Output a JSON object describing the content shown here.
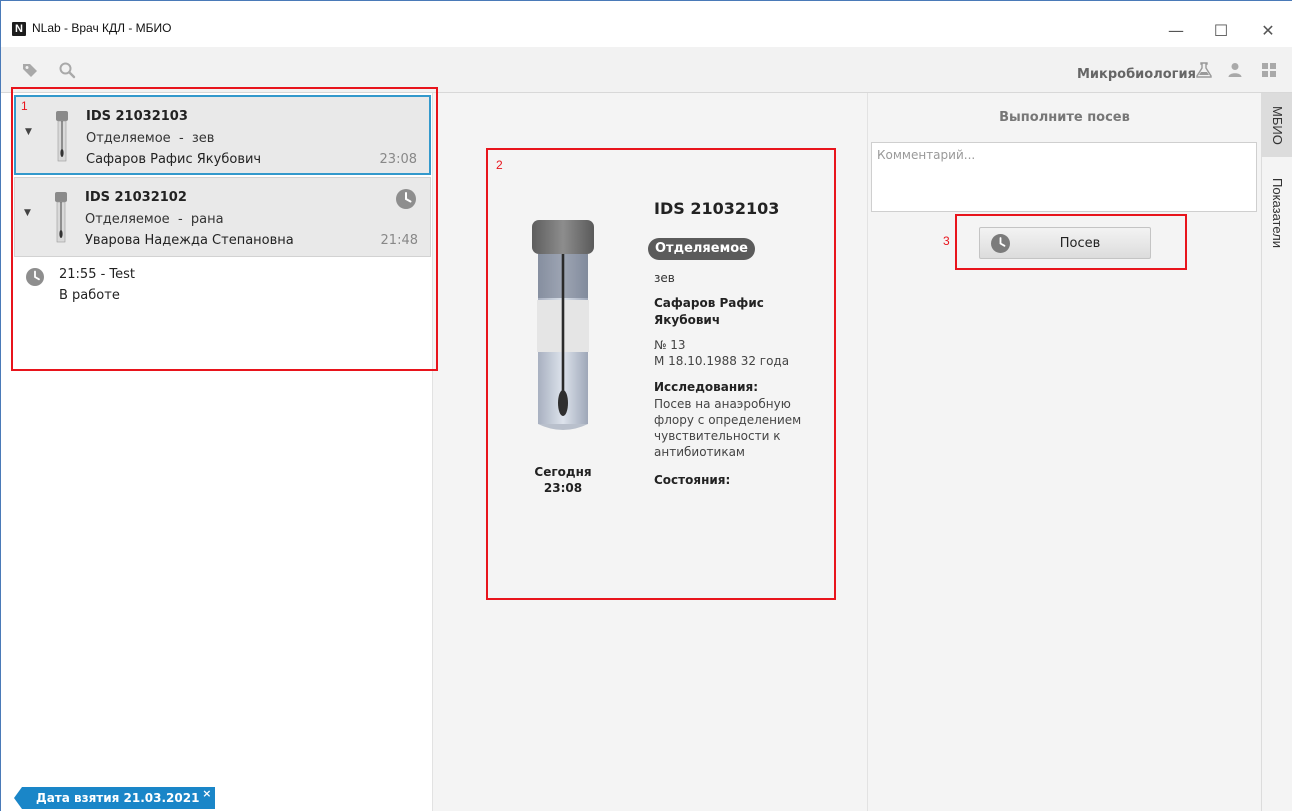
{
  "window": {
    "logo_letter": "N",
    "title": "NLab - Врач КДЛ - МБИО",
    "minimize": "—",
    "maximize": "☐",
    "close": "✕"
  },
  "toolbar": {
    "module_label": "Микробиология",
    "icons": [
      "tag-icon",
      "search-icon",
      "flask-icon",
      "user-icon",
      "grid-icon"
    ]
  },
  "samples": [
    {
      "id": "IDS 21032103",
      "material": "Отделяемое  -  зев",
      "patient": "Сафаров Рафис Якубович",
      "time": "23:08",
      "selected": true
    },
    {
      "id": "IDS 21032102",
      "material": "Отделяемое  -  рана",
      "patient": "Уварова Надежда Степановна",
      "time": "21:48",
      "selected": false
    }
  ],
  "task": {
    "line": "21:55 - Test",
    "status": "В работе"
  },
  "filter_chip": {
    "label": "Дата взятия 21.03.2021",
    "close": "×"
  },
  "detail": {
    "taken_day": "Сегодня",
    "taken_time": "23:08",
    "id": "IDS 21032103",
    "material_badge": "Отделяемое",
    "material": "зев",
    "patient": "Сафаров Рафис Якубович",
    "number": "№ 13",
    "demographics": "М  18.10.1988  32 года",
    "research_label": "Исследования:",
    "research": "Посев на анаэробную флору с определением чувствительности к антибиотикам",
    "states_label": "Состояния:"
  },
  "action_panel": {
    "title": "Выполните посев",
    "comment_placeholder": "Комментарий...",
    "sow_button": "Посев"
  },
  "side_tabs": [
    "МБИО",
    "Показатели"
  ],
  "annotations": [
    "1",
    "2",
    "3"
  ],
  "colors": {
    "accent": "#1a86c8",
    "selection": "#3399cc",
    "annotation": "#e8141c",
    "badge": "#5b5b5b"
  }
}
